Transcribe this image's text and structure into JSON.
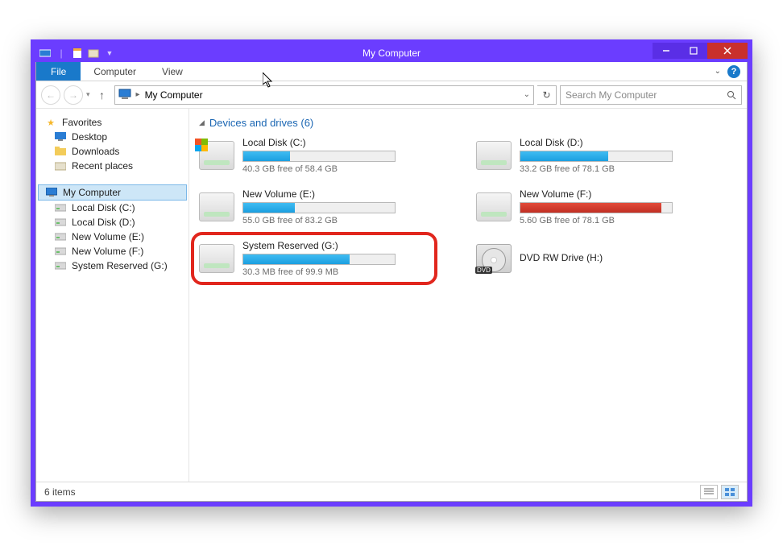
{
  "window": {
    "title": "My Computer"
  },
  "ribbon": {
    "file": "File",
    "computer": "Computer",
    "view": "View"
  },
  "address": {
    "location": "My Computer"
  },
  "search": {
    "placeholder": "Search My Computer"
  },
  "sidebar": {
    "favorites": {
      "label": "Favorites",
      "items": [
        "Desktop",
        "Downloads",
        "Recent places"
      ]
    },
    "computer": {
      "label": "My Computer",
      "items": [
        "Local Disk (C:)",
        "Local Disk (D:)",
        "New Volume (E:)",
        "New Volume (F:)",
        "System Reserved (G:)"
      ]
    }
  },
  "section": {
    "heading": "Devices and drives (6)"
  },
  "drives": [
    {
      "name": "Local Disk (C:)",
      "free": "40.3 GB free of 58.4 GB",
      "pct": 31,
      "color": "blue",
      "os": true
    },
    {
      "name": "Local Disk (D:)",
      "free": "33.2 GB free of 78.1 GB",
      "pct": 58,
      "color": "blue"
    },
    {
      "name": "New Volume (E:)",
      "free": "55.0 GB free of 83.2 GB",
      "pct": 34,
      "color": "blue"
    },
    {
      "name": "New Volume (F:)",
      "free": "5.60 GB free of 78.1 GB",
      "pct": 93,
      "color": "red"
    },
    {
      "name": "System Reserved (G:)",
      "free": "30.3 MB free of 99.9 MB",
      "pct": 70,
      "color": "blue",
      "highlight": true
    },
    {
      "name": "DVD RW Drive (H:)",
      "dvd": true
    }
  ],
  "status": {
    "count": "6 items"
  }
}
